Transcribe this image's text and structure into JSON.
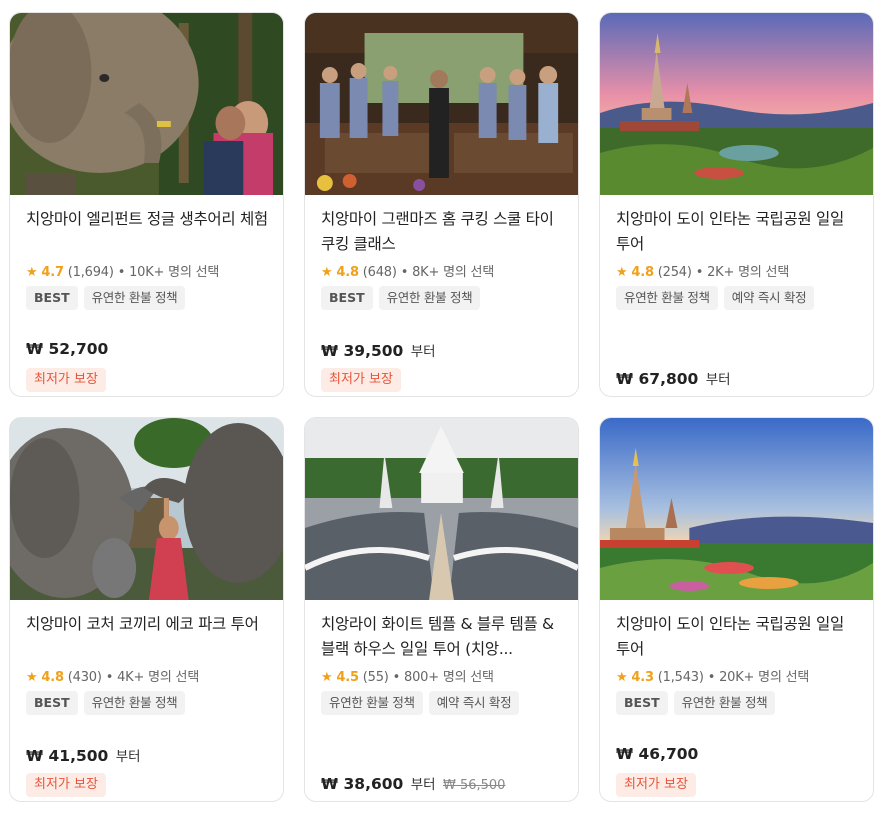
{
  "currency_symbol": "₩",
  "products": [
    {
      "title": "치앙마이 엘리펀트 정글 생추어리 체험",
      "rating": "4.7",
      "reviews": "(1,694)",
      "selected": "• 10K+ 명의 선택",
      "tags": [
        "BEST",
        "유연한 환불 정책"
      ],
      "price": "₩ 52,700",
      "price_suffix": "",
      "original_price": "",
      "guarantee": "최저가 보장",
      "image": "elephant-feeding-photo"
    },
    {
      "title": "치앙마이 그랜마즈 홈 쿠킹 스쿨 타이 쿠킹 클래스",
      "rating": "4.8",
      "reviews": "(648)",
      "selected": "• 8K+ 명의 선택",
      "tags": [
        "BEST",
        "유연한 환불 정책"
      ],
      "price": "₩ 39,500",
      "price_suffix": "부터",
      "original_price": "",
      "guarantee": "최저가 보장",
      "image": "cooking-class-photo"
    },
    {
      "title": "치앙마이 도이 인타논 국립공원 일일 투어",
      "rating": "4.8",
      "reviews": "(254)",
      "selected": "• 2K+ 명의 선택",
      "tags": [
        "유연한 환불 정책",
        "예약 즉시 확정"
      ],
      "price": "₩ 67,800",
      "price_suffix": "부터",
      "original_price": "",
      "guarantee": "",
      "image": "pagoda-sunset-photo"
    },
    {
      "title": "치앙마이 코처 코끼리 에코 파크 투어",
      "rating": "4.8",
      "reviews": "(430)",
      "selected": "• 4K+ 명의 선택",
      "tags": [
        "BEST",
        "유연한 환불 정책"
      ],
      "price": "₩ 41,500",
      "price_suffix": "부터",
      "original_price": "",
      "guarantee": "최저가 보장",
      "image": "elephant-park-photo"
    },
    {
      "title": "치앙라이 화이트 템플 & 블루 템플 & 블랙 하우스 일일 투어 (치앙...",
      "rating": "4.5",
      "reviews": "(55)",
      "selected": "• 800+ 명의 선택",
      "tags": [
        "유연한 환불 정책",
        "예약 즉시 확정"
      ],
      "price": "₩ 38,600",
      "price_suffix": "부터",
      "original_price": "₩ 56,500",
      "guarantee": "",
      "image": "white-temple-photo"
    },
    {
      "title": "치앙마이 도이 인타논 국립공원 일일 투어",
      "rating": "4.3",
      "reviews": "(1,543)",
      "selected": "• 20K+ 명의 선택",
      "tags": [
        "BEST",
        "유연한 환불 정책"
      ],
      "price": "₩ 46,700",
      "price_suffix": "",
      "original_price": "",
      "guarantee": "최저가 보장",
      "image": "pagoda-garden-photo"
    }
  ],
  "colors": {
    "star": "#f0a11b",
    "guarantee_bg": "#fdece6",
    "guarantee_text": "#e8543a",
    "tag_bg": "#f2f2f2"
  }
}
